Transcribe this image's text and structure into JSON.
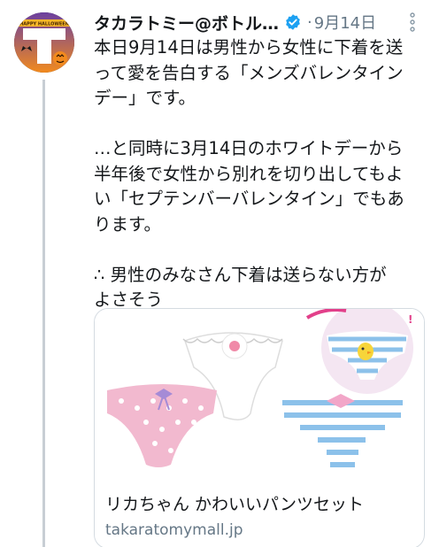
{
  "tweet": {
    "display_name": "タカラトミー@ボトル…",
    "date": "9月14日",
    "separator": "·",
    "text": "本日9月14日は男性から女性に下着を送\nって愛を告白する「メンズバレンタイン\nデー」です。\n\n…と同時に3月14日のホワイトデーから\n半年後で女性から別れを切り出してもよ\nい「セプテンバーバレンタイン」でもあ\nります。\n\n∴ 男性のみなさん下着は送らない方が\nよさそう",
    "avatar_text": "HAPPY HALLOWEEN"
  },
  "card": {
    "title": "リカちゃん かわいいパンツセット",
    "domain": "takaratomymall.jp"
  },
  "colors": {
    "verified": "#1da1f2",
    "secondary_text": "#657786",
    "avatar_orange": "#f28a1e",
    "avatar_purple": "#6b3fa0"
  },
  "icons": {
    "verified": "verified-badge-icon",
    "more": "more-vertical-icon"
  }
}
